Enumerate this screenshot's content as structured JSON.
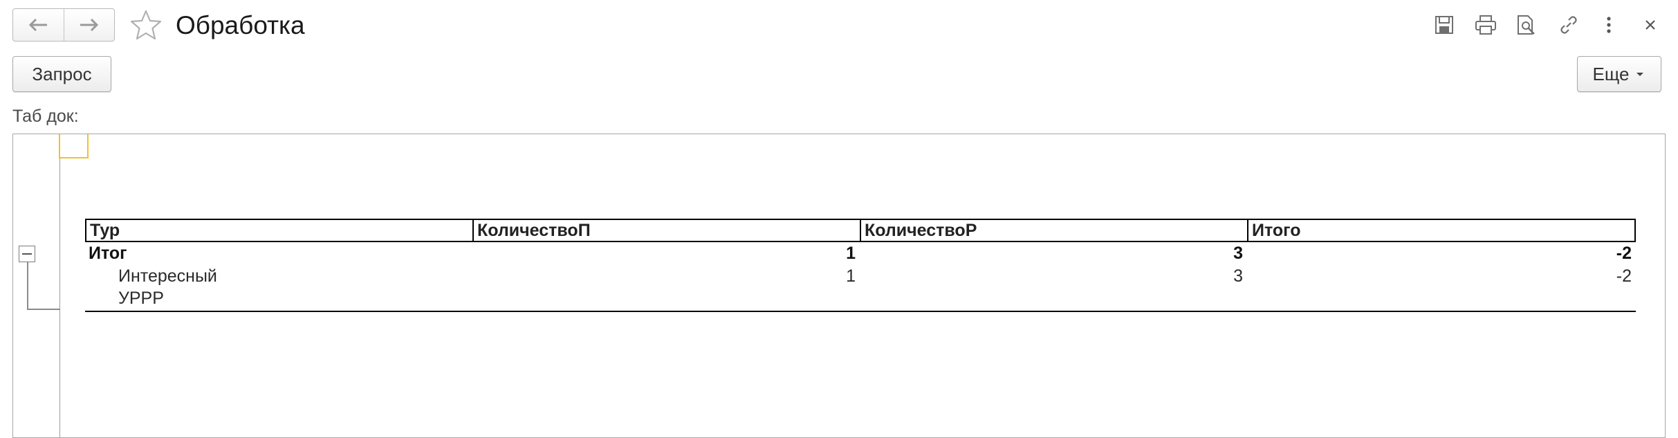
{
  "window": {
    "title": "Обработка"
  },
  "toolbar": {
    "icons": [
      "save-icon",
      "print-icon",
      "preview-icon",
      "link-icon",
      "more-vertical-icon",
      "close-icon"
    ]
  },
  "actions": {
    "query_label": "Запрос",
    "more_label": "Еще"
  },
  "form": {
    "field_label": "Таб док:"
  },
  "report": {
    "columns": [
      "Тур",
      "КоличествоП",
      "КоличествоР",
      "Итого"
    ],
    "total_row": {
      "label": "Итог",
      "values": [
        "1",
        "3",
        "-2"
      ]
    },
    "detail_rows": [
      {
        "label_lines": [
          "Интересный",
          "УРРР"
        ],
        "values": [
          "1",
          "3",
          "-2"
        ]
      }
    ]
  },
  "colors": {
    "cell_cursor": "#f2c02e",
    "border": "#a6a6a6"
  }
}
